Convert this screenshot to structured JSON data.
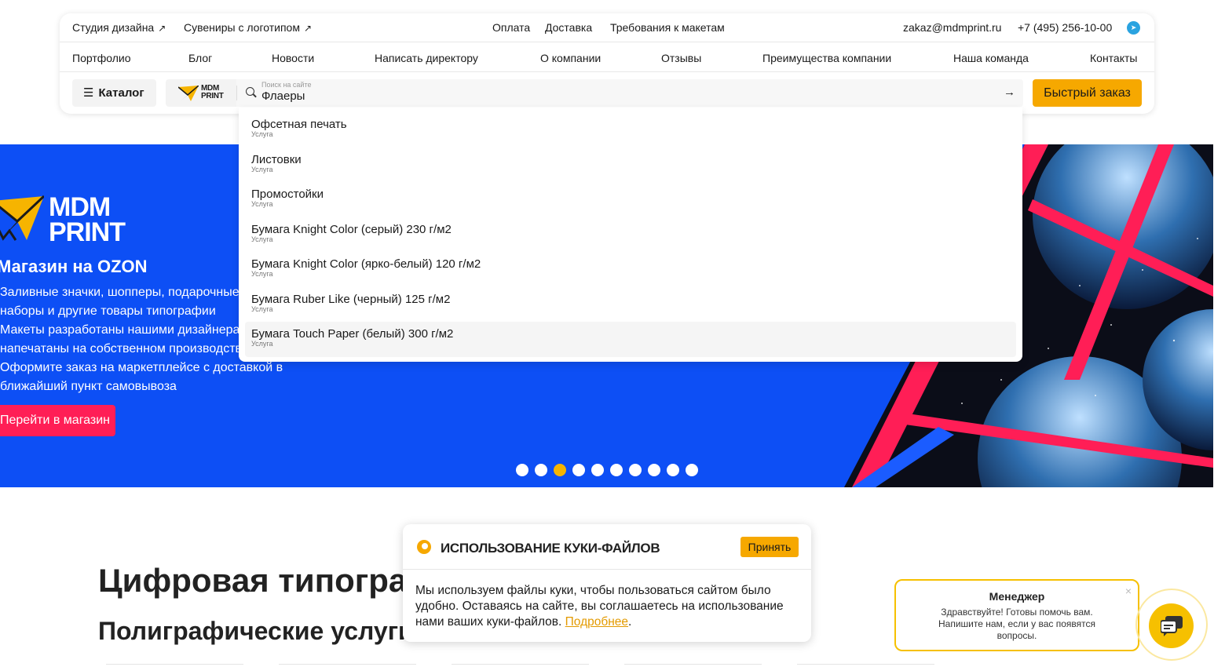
{
  "topbar": {
    "link1": "Студия дизайна",
    "link2": "Сувениры с логотипом",
    "payment": "Оплата",
    "delivery": "Доставка",
    "requirements": "Требования к макетам",
    "email": "zakaz@mdmprint.ru",
    "phone": "+7 (495) 256-10-00"
  },
  "nav": [
    "Портфолио",
    "Блог",
    "Новости",
    "Написать директору",
    "О компании",
    "Отзывы",
    "Преимущества компании",
    "Наша команда",
    "Контакты"
  ],
  "search": {
    "catalog_label": "Каталог",
    "logo_text_1": "MDM",
    "logo_text_2": "PRINT",
    "placeholder": "Поиск на сайте",
    "value": "Флаеры",
    "quick_order": "Быстрый заказ"
  },
  "dropdown": [
    {
      "title": "Офсетная печать",
      "kind": "Услуга"
    },
    {
      "title": "Листовки",
      "kind": "Услуга"
    },
    {
      "title": "Промостойки",
      "kind": "Услуга"
    },
    {
      "title": "Бумага Knight Color (серый) 230 г/м2",
      "kind": "Услуга"
    },
    {
      "title": "Бумага Knight Color (ярко-белый) 120 г/м2",
      "kind": "Услуга"
    },
    {
      "title": "Бумага Ruber Like (черный) 125 г/м2",
      "kind": "Услуга"
    },
    {
      "title": "Бумага Touch Paper (белый) 300 г/м2",
      "kind": "Услуга"
    }
  ],
  "banner": {
    "logo_line1": "MDM",
    "logo_line2": "PRINT",
    "heading": "Магазин на OZON",
    "desc_lines": [
      "Заливные значки, шопперы, подарочные",
      "наборы и другие товары типографии",
      "Макеты разработаны нашими дизайнерами",
      "напечатаны на собственном производстве",
      "Оформите заказ на маркетплейсе с доставкой в",
      "ближайший пункт самовывоза"
    ],
    "button": "Перейти в магазин",
    "slides_total": 10,
    "slide_active": 3,
    "bg_color": "#0d4ff5",
    "button_color": "#ff1e56"
  },
  "main": {
    "title": "Цифровая типография",
    "subtitle": "Полиграфические услуги"
  },
  "cookie": {
    "title": "ИСПОЛЬЗОВАНИЕ КУКИ-ФАЙЛОВ",
    "accept": "Принять",
    "text": "Мы используем файлы куки, чтобы пользоваться сайтом было удобно. Оставаясь на сайте, вы соглашаетесь на использование нами ваших куки-файлов. ",
    "more": "Подробнее"
  },
  "chat": {
    "name": "Менеджер",
    "message": "Здравствуйте! Готовы помочь вам. Напишите нам, если у вас появятся вопросы."
  },
  "colors": {
    "accent": "#f6a800",
    "brand_blue": "#0d4ff5"
  }
}
